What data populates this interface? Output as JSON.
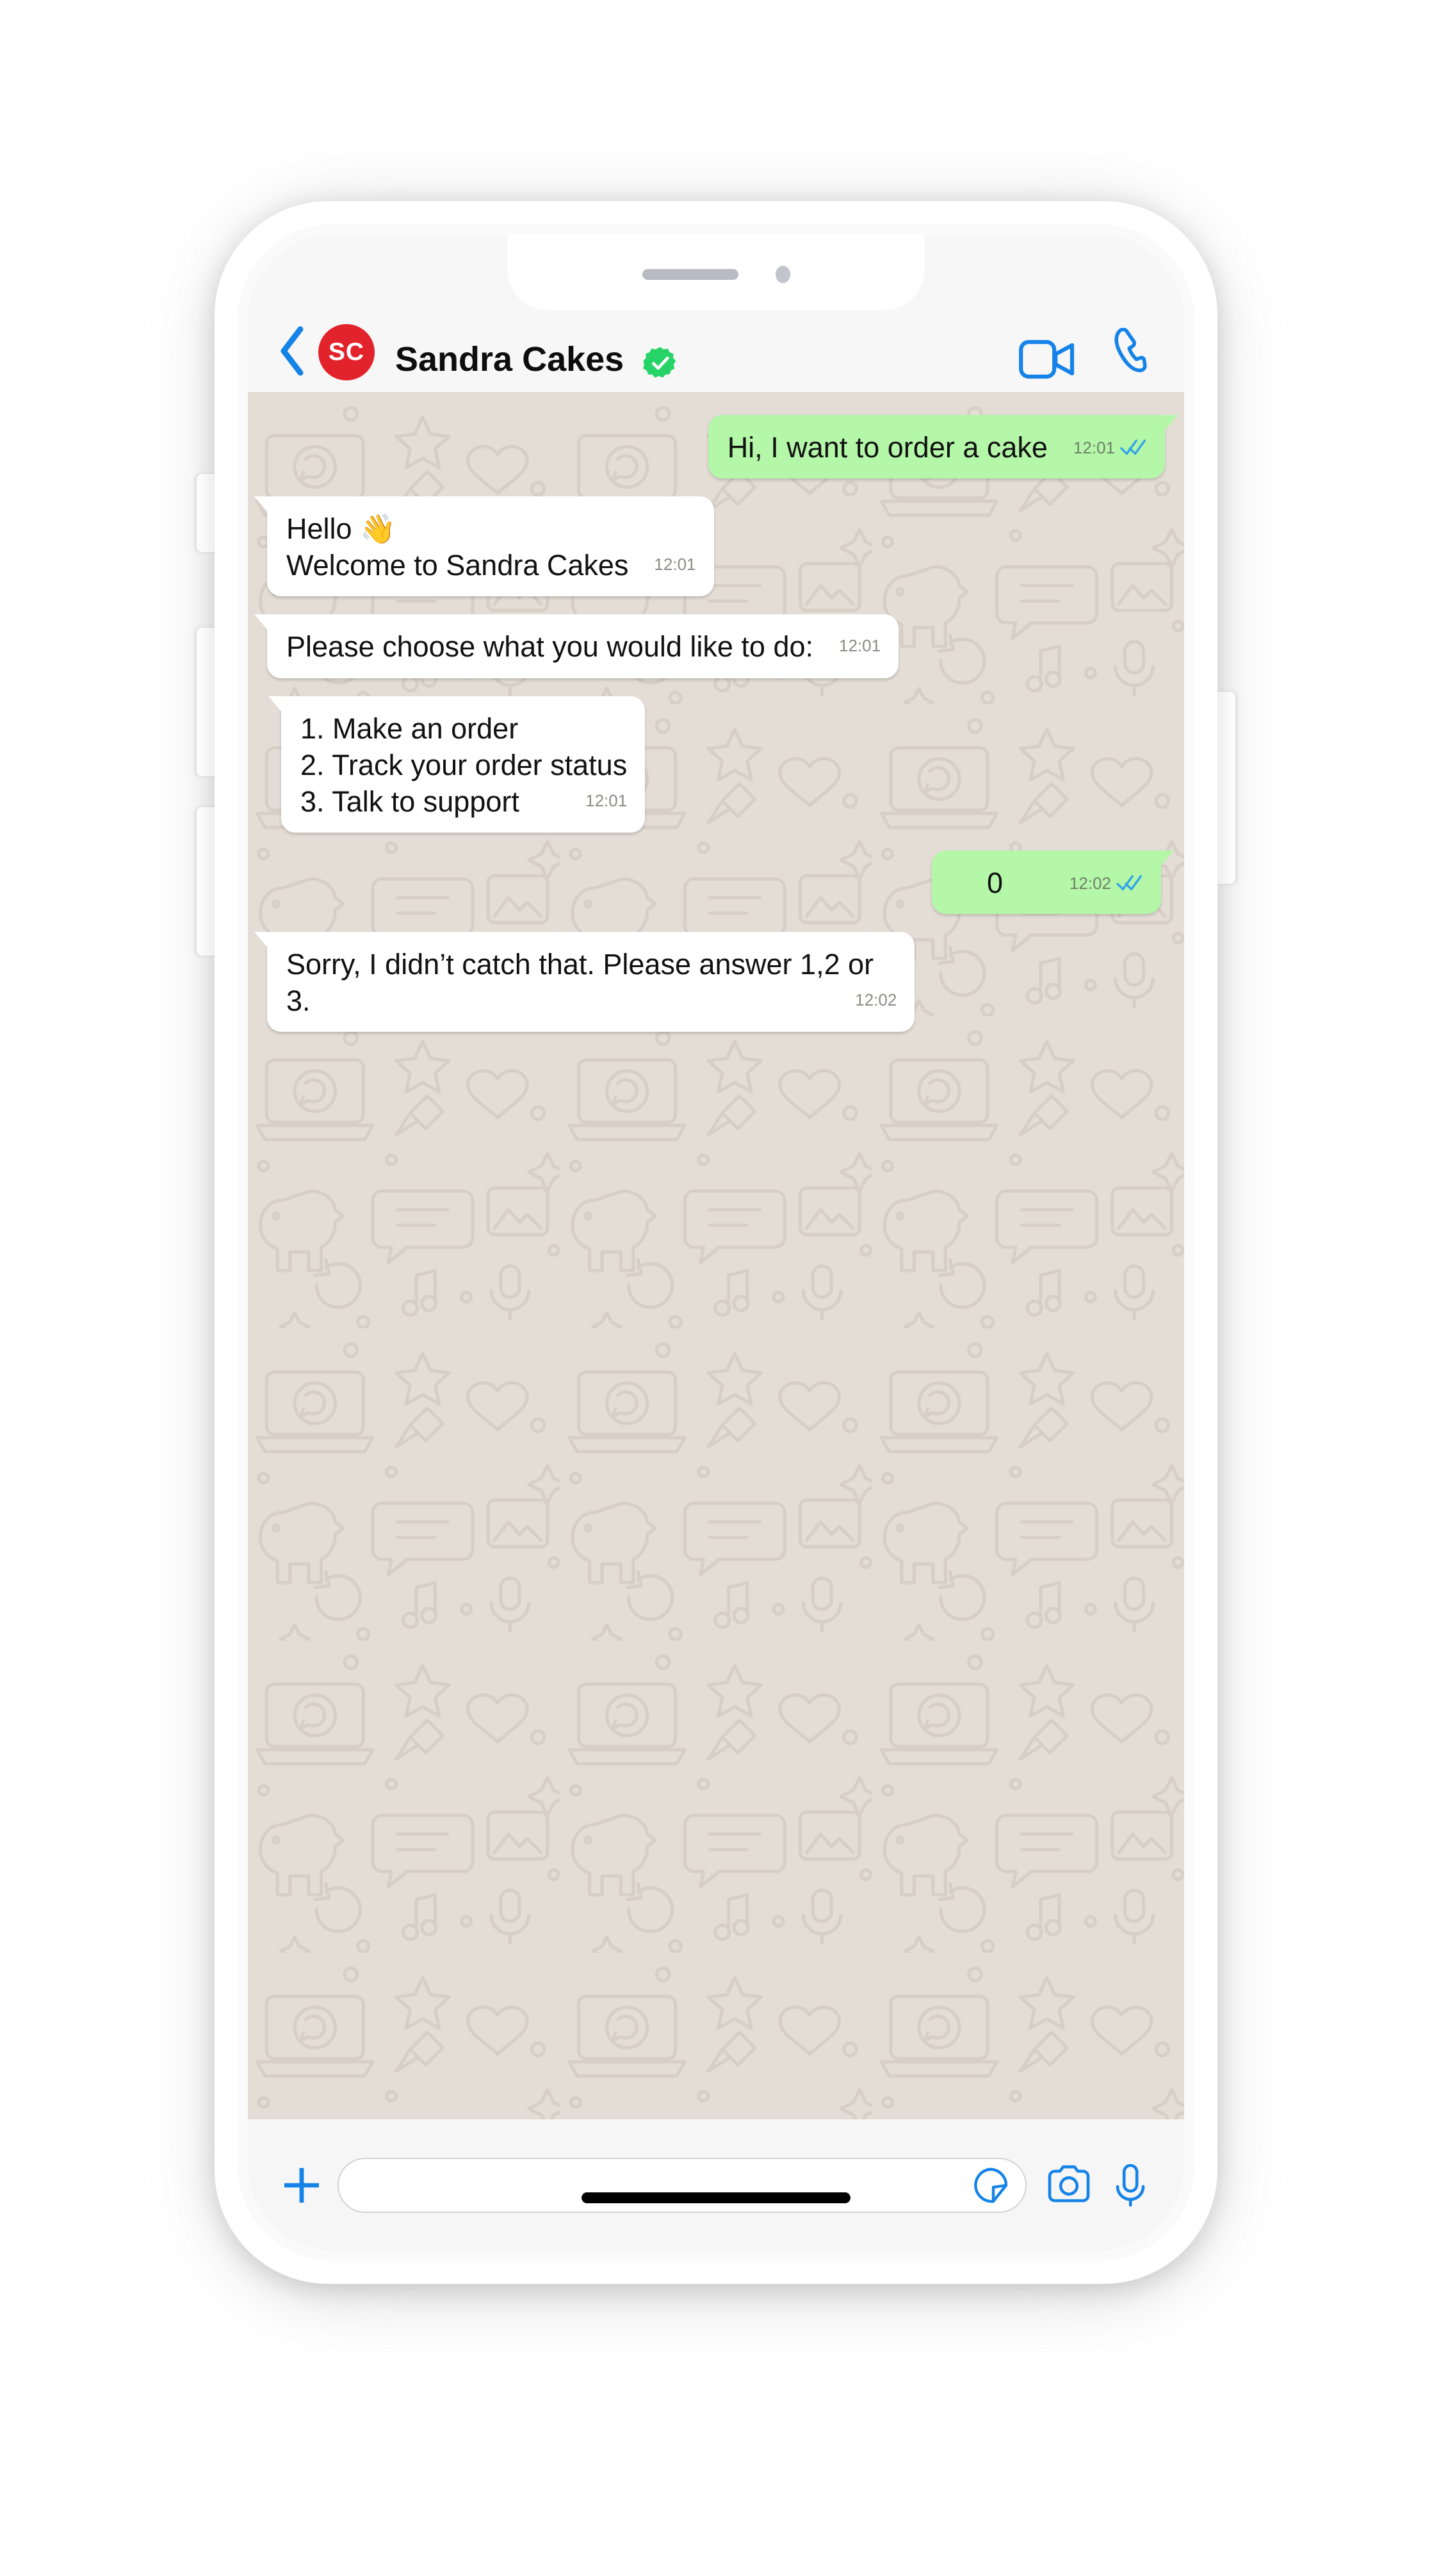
{
  "device": {
    "type": "smartphone-mockup",
    "notch": {
      "speaker_icon": "speaker-grille",
      "camera_icon": "front-camera-dot"
    },
    "buttons": [
      "silent-switch",
      "volume-up",
      "volume-down",
      "power"
    ],
    "home_indicator": "home-indicator-bar"
  },
  "header": {
    "back_icon": "back-chevron-icon",
    "avatar_initials": "SC",
    "avatar_color": "#E2232B",
    "contact_name": "Sandra Cakes",
    "verified_icon": "verified-badge-icon",
    "verified_color": "#25D366",
    "video_call_icon": "video-camera-icon",
    "voice_call_icon": "phone-icon",
    "accent_color": "#1583E8"
  },
  "chat": {
    "wallpaper": "whatsapp-doodle-pattern",
    "wallpaper_color": "#E4DDD6",
    "outgoing_bubble_color": "#B4F7A8",
    "incoming_bubble_color": "#FFFFFF",
    "tick_color": "#34A4E8",
    "messages": [
      {
        "direction": "outgoing",
        "text": "Hi, I want to order a cake",
        "time": "12:01",
        "status": "read",
        "ticks": "double-check-icon"
      },
      {
        "direction": "incoming",
        "text": "Hello 👋\nWelcome to Sandra Cakes",
        "time": "12:01",
        "status": "",
        "ticks": ""
      },
      {
        "direction": "incoming",
        "text": "Please choose what you would like to do:",
        "time": "12:01",
        "status": "",
        "ticks": ""
      },
      {
        "direction": "incoming",
        "text": "1. Make an order\n2. Track your order status\n3. Talk to support",
        "time": "12:01",
        "status": "",
        "ticks": ""
      },
      {
        "direction": "outgoing",
        "text": "0",
        "time": "12:02",
        "status": "read",
        "ticks": "double-check-icon"
      },
      {
        "direction": "incoming",
        "text": "Sorry, I didn’t catch that. Please answer 1,2 or 3.",
        "time": "12:02",
        "status": "",
        "ticks": ""
      }
    ]
  },
  "input_bar": {
    "attach_icon": "plus-icon",
    "message_value": "",
    "message_placeholder": "",
    "sticker_icon": "sticker-icon",
    "camera_icon": "camera-icon",
    "mic_icon": "microphone-icon"
  }
}
